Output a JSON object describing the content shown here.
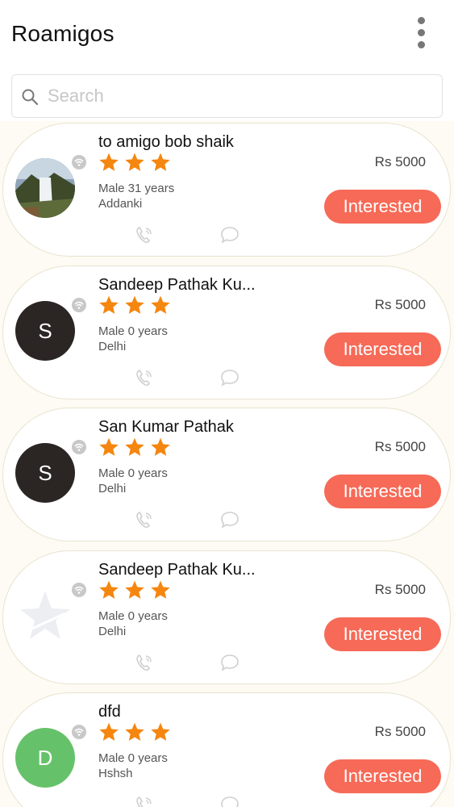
{
  "header": {
    "title": "Roamigos",
    "menu_icon": "more-vert-icon"
  },
  "search": {
    "placeholder": "Search",
    "value": "",
    "icon": "search-icon"
  },
  "colors": {
    "accent": "#f66a57",
    "star": "#f5860f",
    "avatar_dark": "#2b2624",
    "avatar_green": "#66c26a"
  },
  "cards": [
    {
      "name": "to amigo bob shaik",
      "stars": 3,
      "gender_age": "Male 31 years",
      "location": "Addanki",
      "price": "Rs 5000",
      "button": "Interested",
      "avatar_type": "photo",
      "avatar_letter": ""
    },
    {
      "name": "Sandeep Pathak Ku...",
      "stars": 3,
      "gender_age": "Male 0 years",
      "location": "Delhi",
      "price": "Rs 5000",
      "button": "Interested",
      "avatar_type": "dark",
      "avatar_letter": "S"
    },
    {
      "name": "San Kumar Pathak",
      "stars": 3,
      "gender_age": "Male 0 years",
      "location": "Delhi",
      "price": "Rs 5000",
      "button": "Interested",
      "avatar_type": "dark",
      "avatar_letter": "S"
    },
    {
      "name": "Sandeep Pathak Ku...",
      "stars": 3,
      "gender_age": "Male 0 years",
      "location": "Delhi",
      "price": "Rs 5000",
      "button": "Interested",
      "avatar_type": "placeholder",
      "avatar_letter": ""
    },
    {
      "name": "dfd",
      "stars": 3,
      "gender_age": "Male 0 years",
      "location": "Hshsh",
      "price": "Rs 5000",
      "button": "Interested",
      "avatar_type": "green",
      "avatar_letter": "D"
    }
  ]
}
